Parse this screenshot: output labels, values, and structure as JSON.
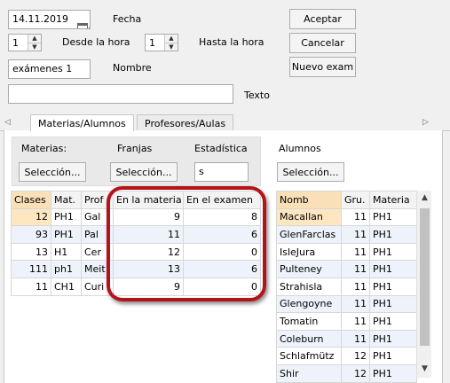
{
  "form": {
    "date_value": "14.11.2019",
    "fecha_label": "Fecha",
    "desde_value": "1",
    "desde_label": "Desde la hora",
    "hasta_value": "1",
    "hasta_label": "Hasta la hora",
    "nombre_value": "exámenes 1",
    "nombre_label": "Nombre",
    "texto_value": "",
    "texto_label": "Texto"
  },
  "buttons": {
    "aceptar": "Aceptar",
    "cancelar": "Cancelar",
    "nuevo": "Nuevo exam"
  },
  "tabs": [
    "Materias/Alumnos",
    "Profesores/Aulas"
  ],
  "filters": {
    "materias_label": "Materias:",
    "materias_button": "Selección...",
    "franjas_label": "Franjas",
    "franjas_button": "Selección...",
    "estadistica_label": "Estadística",
    "estadistica_value": "s",
    "alumnos_label": "Alumnos",
    "alumnos_button": "Selección..."
  },
  "left_grid": {
    "headers": [
      "Clases",
      "Mat.",
      "Prof",
      "En la materia",
      "En el examen"
    ],
    "rows": [
      [
        "12",
        "PH1",
        "Gal",
        "9",
        "8"
      ],
      [
        "93",
        "PH1",
        "Pal",
        "11",
        "6"
      ],
      [
        "13",
        "H1",
        "Cer",
        "12",
        "0"
      ],
      [
        "111",
        "ph1",
        "Meit",
        "13",
        "6"
      ],
      [
        "11",
        "CH1",
        "Curi",
        "9",
        "0"
      ]
    ]
  },
  "right_grid": {
    "headers": [
      "Nomb",
      "Gru.",
      "Materia"
    ],
    "rows": [
      [
        "Macallan",
        "11",
        "PH1"
      ],
      [
        "GlenFarclas",
        "11",
        "PH1"
      ],
      [
        "IsleJura",
        "11",
        "PH1"
      ],
      [
        "Pulteney",
        "11",
        "PH1"
      ],
      [
        "Strahisla",
        "11",
        "PH1"
      ],
      [
        "Glengoyne",
        "11",
        "PH1"
      ],
      [
        "Tomatin",
        "11",
        "PH1"
      ],
      [
        "Coleburn",
        "11",
        "PH1"
      ],
      [
        "Schlafmütz",
        "12",
        "PH1"
      ],
      [
        "Shir",
        "12",
        "PH1"
      ]
    ]
  },
  "colors": {
    "callout": "#b3141c",
    "header_selected": "#f9e0b8",
    "row_alt": "#eef3fb"
  }
}
